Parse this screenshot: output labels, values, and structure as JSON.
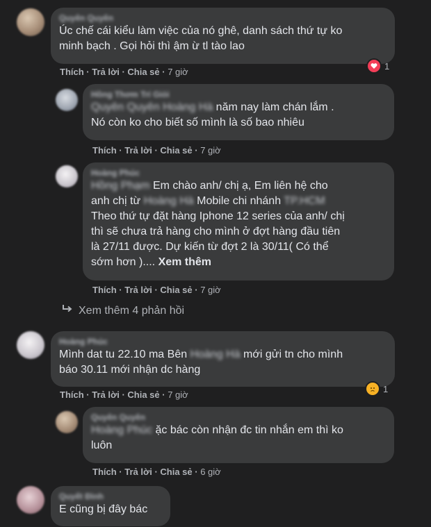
{
  "comments": [
    {
      "author": "Quyên Quyên",
      "text": "Úc chế cái kiểu làm việc của nó ghê, danh sách thứ tự ko\nminh bạch . Gọi hỏi thì ậm ừ tl tào lao",
      "like": "Thích",
      "reply": "Trả lời",
      "share": "Chia sẻ",
      "time": "7 giờ",
      "reaction_count": "1",
      "reaction_icon": "heart-reaction-icon"
    },
    {
      "author": "Hồng Thơm Trí Giỏi",
      "mention": "Quyên Quyên Hoàng Hà",
      "text": " năm nay làm chán lắm .\nNó còn ko cho biết số mình là số bao nhiêu",
      "like": "Thích",
      "reply": "Trả lời",
      "share": "Chia sẻ",
      "time": "7 giờ"
    },
    {
      "author": "Hoàng Phúc",
      "mention": "Hồng Phạm",
      "text_1": " Em chào anh/ chị ạ, Em liên hệ cho\nanh chị từ ",
      "mention_2": "Hoàng Hà",
      "text_2": " Mobile chi nhánh ",
      "mention_3": "TP.HCM",
      "text_3": "\nTheo thứ tự đặt hàng Iphone 12 series của anh/ chị\nthì sẽ chưa trả hàng cho mình ở đợt hàng đầu tiên\nlà 27/11 được. Dự kiến từ đợt 2 là 30/11( Có thể\nsớm hơn )....",
      "see_more": "Xem thêm",
      "like": "Thích",
      "reply": "Trả lời",
      "share": "Chia sẻ",
      "time": "7 giờ"
    },
    {
      "author": "Hoàng Phúc",
      "text_1": "Mình dat tu 22.10 ma Bên ",
      "mention": "Hoàng Hà",
      "text_2": " mới gửi tn cho mình\nbáo 30.11 mới nhận dc hàng",
      "like": "Thích",
      "reply": "Trả lời",
      "share": "Chia sẻ",
      "time": "7 giờ",
      "reaction_count": "1",
      "reaction_icon": "sad-reaction-icon"
    },
    {
      "author": "Quyên Quyên",
      "mention": "Hoàng Phúc",
      "text": " ặc bác còn nhận đc tin nhắn em thì ko\nluôn",
      "like": "Thích",
      "reply": "Trả lời",
      "share": "Chia sẻ",
      "time": "6 giờ"
    },
    {
      "author": "Quyết Đình",
      "text": "E cũng bị đây bác"
    }
  ],
  "view_more_replies": "Xem thêm 4 phản hồi",
  "colors": {
    "background": "#1f1f20",
    "bubble": "#3a3b3c",
    "text": "#e4e6eb",
    "muted": "#b0b3b8",
    "heart": "#f33e58",
    "sad": "#f7b125"
  }
}
